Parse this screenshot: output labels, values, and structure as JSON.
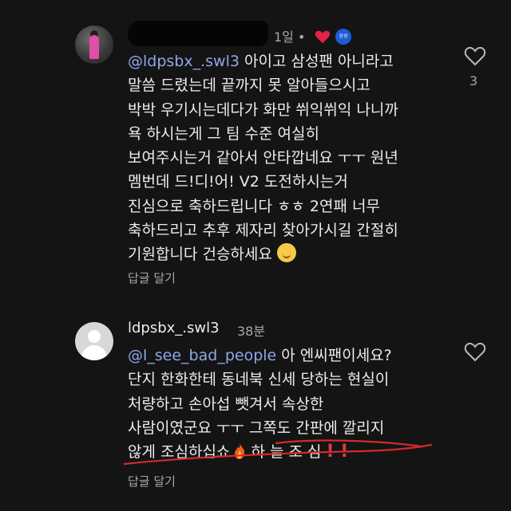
{
  "comment1": {
    "time": "1일 •",
    "badge_text": "삼성",
    "mention": "@ldpsbx_.swl3",
    "line1_rest": " 아이고 삼성팬 아니라고",
    "lines": [
      "말씀 드렸는데 끝까지 못 알아들으시고",
      "박박 우기시는데다가 화만 쒸익쒸익 나니까",
      "욕 하시는게 그 팀 수준 여실히",
      "보여주시는거 같아서 안타깝네요 ㅜㅜ 원년",
      "멤번데 드!디!어! V2 도전하시는거",
      "진심으로 축하드립니다 ㅎㅎ 2연패 너무",
      "축하드리고 추후 제자리 찾아가시길 간절히",
      "기원합니다 건승하세요"
    ],
    "reply_label": "답글 달기",
    "like_count": "3"
  },
  "comment2": {
    "username": "ldpsbx_.swl3",
    "time": "38분",
    "mention": "@l_see_bad_people",
    "line1_rest": " 아 엔씨팬이세요?",
    "lines": [
      "단지 한화한테 동네북 신세 당하는 현실이",
      "처량하고 손아섭 뺏겨서 속상한",
      "사람이였군요 ㅜㅜ 그쪽도 간판에 깔리지"
    ],
    "last_line_start": "않게 조심하십쇼",
    "last_line_end": " 하 늘 조 심 ",
    "exclaim": "! !",
    "reply_label": "답글 달기"
  },
  "colors": {
    "background": "#141414",
    "mention": "#8fa7e8",
    "heart": "#e0244a",
    "annotation": "#d42a2a"
  }
}
